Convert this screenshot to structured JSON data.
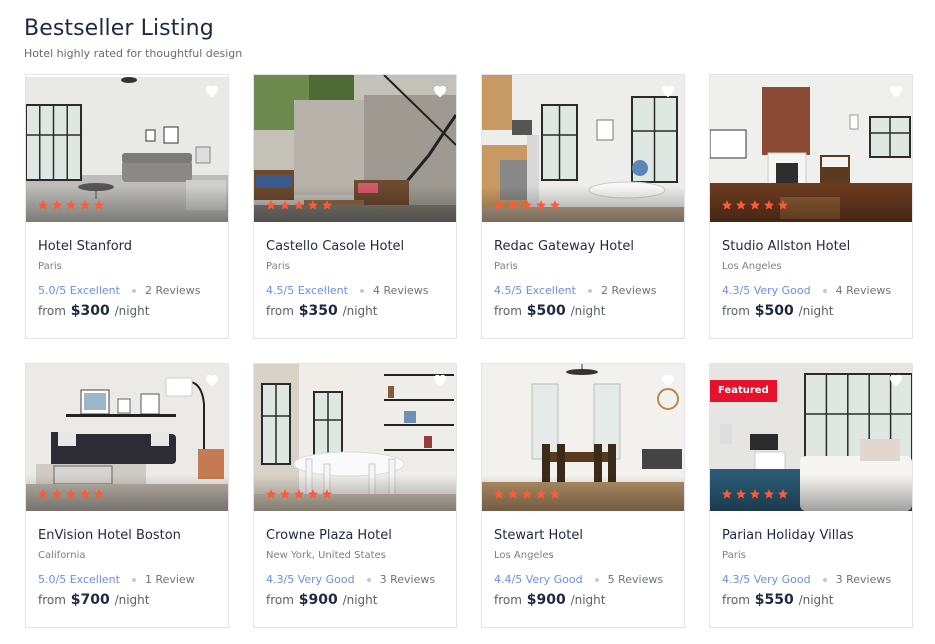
{
  "section": {
    "title": "Bestseller Listing",
    "subtitle": "Hotel highly rated for thoughtful design"
  },
  "listings": [
    {
      "name": "Hotel Stanford",
      "city": "Paris",
      "rating": "5.0/5 Excellent",
      "reviews": "2 Reviews",
      "from": "from",
      "price": "$300",
      "per": "/night",
      "stars": 5,
      "featured": false,
      "favorite_icon": "heart-icon",
      "photo": "living-room"
    },
    {
      "name": "Castello Casole Hotel",
      "city": "Paris",
      "rating": "4.5/5 Excellent",
      "reviews": "4 Reviews",
      "from": "from",
      "price": "$350",
      "per": "/night",
      "stars": 5,
      "featured": false,
      "favorite_icon": "heart-icon",
      "photo": "patio"
    },
    {
      "name": "Redac Gateway Hotel",
      "city": "Paris",
      "rating": "4.5/5 Excellent",
      "reviews": "2 Reviews",
      "from": "from",
      "price": "$500",
      "per": "/night",
      "stars": 5,
      "featured": false,
      "favorite_icon": "heart-icon",
      "photo": "kitchen"
    },
    {
      "name": "Studio Allston Hotel",
      "city": "Los Angeles",
      "rating": "4.3/5 Very Good",
      "reviews": "4 Reviews",
      "from": "from",
      "price": "$500",
      "per": "/night",
      "stars": 5,
      "featured": false,
      "favorite_icon": "heart-icon",
      "photo": "brick-room"
    },
    {
      "name": "EnVision Hotel Boston",
      "city": "California",
      "rating": "5.0/5 Excellent",
      "reviews": "1 Review",
      "from": "from",
      "price": "$700",
      "per": "/night",
      "stars": 5,
      "featured": false,
      "favorite_icon": "heart-icon",
      "photo": "sofa-room"
    },
    {
      "name": "Crowne Plaza Hotel",
      "city": "New York, United States",
      "rating": "4.3/5 Very Good",
      "reviews": "3 Reviews",
      "from": "from",
      "price": "$900",
      "per": "/night",
      "stars": 5,
      "featured": false,
      "favorite_icon": "heart-icon",
      "photo": "dining-shelves"
    },
    {
      "name": "Stewart Hotel",
      "city": "Los Angeles",
      "rating": "4.4/5 Very Good",
      "reviews": "5 Reviews",
      "from": "from",
      "price": "$900",
      "per": "/night",
      "stars": 5,
      "featured": false,
      "favorite_icon": "heart-icon",
      "photo": "dining-hall"
    },
    {
      "name": "Parian Holiday Villas",
      "city": "Paris",
      "rating": "4.3/5 Very Good",
      "reviews": "3 Reviews",
      "from": "from",
      "price": "$550",
      "per": "/night",
      "stars": 5,
      "featured": true,
      "badge": "Featured",
      "favorite_icon": "heart-icon",
      "photo": "bedroom"
    }
  ],
  "colors": {
    "star": "#ff5a36",
    "rating": "#6b8ee6",
    "badge": "#e8112d"
  }
}
